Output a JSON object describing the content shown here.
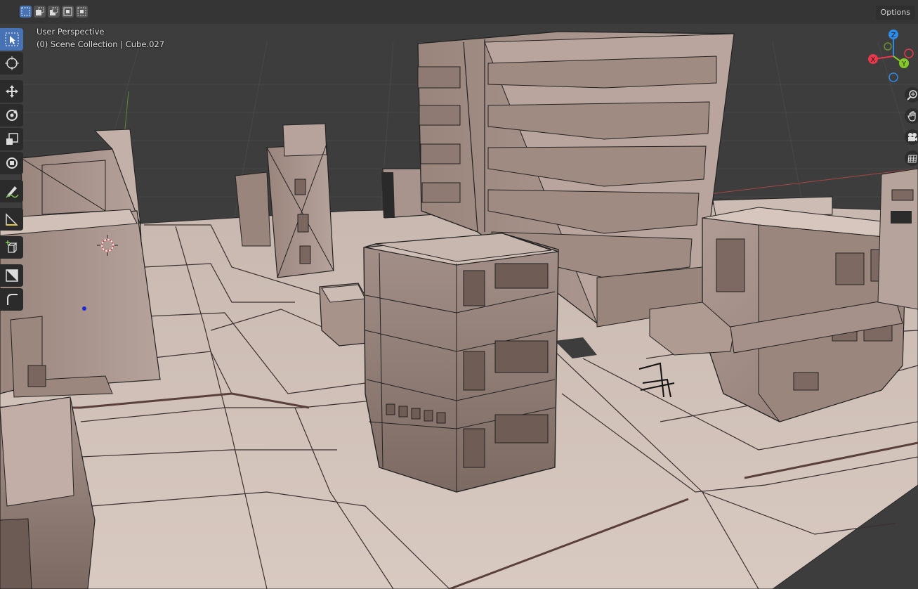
{
  "viewport": {
    "view_name": "User Perspective",
    "collection_info": "(0) Scene Collection | Cube.027",
    "options_label": "Options"
  },
  "header": {
    "selection_modes": [
      "select-new-icon",
      "select-extend-icon",
      "select-subtract-icon",
      "select-invert-icon",
      "select-intersect-icon"
    ]
  },
  "toolbar": {
    "tools": [
      "select-box-icon",
      "cursor-icon",
      "move-icon",
      "rotate-icon",
      "scale-icon",
      "transform-icon",
      "annotate-icon",
      "measure-icon",
      "add-cube-icon",
      "shear-icon",
      "extrude-icon"
    ]
  },
  "gizmo": {
    "x_label": "X",
    "y_label": "Y",
    "z_label": "Z",
    "x_color": "#e8394c",
    "y_color": "#86c82a",
    "z_color": "#2c8ce8"
  },
  "navigation": [
    "zoom-icon",
    "pan-hand-icon",
    "camera-view-icon",
    "ortho-grid-icon"
  ],
  "colors": {
    "viewport_bg": "#3d3d3d",
    "grid": "#4a4a4a",
    "model": "#a8928a",
    "model_light": "#c9b9b1",
    "ground": "#d3c3bb",
    "accent": "#4772b3"
  }
}
